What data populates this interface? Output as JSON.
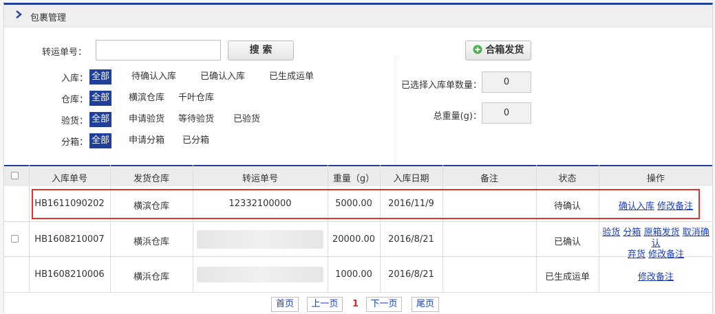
{
  "header": {
    "title": "包裹管理",
    "icon": "chevron-right-icon"
  },
  "filters": {
    "tracking_label": "转运单号：",
    "tracking_value": "",
    "search_label": "搜 索",
    "inbound": {
      "label": "入库：",
      "options": [
        "全部",
        "待确认入库",
        "已确认入库",
        "已生成运单"
      ],
      "selected": 0
    },
    "warehouse": {
      "label": "仓库：",
      "options": [
        "全部",
        "横滨仓库",
        "千叶仓库"
      ],
      "selected": 0
    },
    "inspection": {
      "label": "验货：",
      "options": [
        "全部",
        "申请验货",
        "等待验货",
        "已验货"
      ],
      "selected": 0
    },
    "boxing": {
      "label": "分箱：",
      "options": [
        "全部",
        "申请分箱",
        "已分箱"
      ],
      "selected": 0
    }
  },
  "summary": {
    "merge_label": "合箱发货",
    "merge_icon": "plus-circle-icon",
    "selected_count_label": "已选择入库单数量：",
    "selected_count": "0",
    "total_weight_label": "总重量(g)：",
    "total_weight": "0"
  },
  "table": {
    "headers": [
      "入库单号",
      "发货仓库",
      "转运单号",
      "重量（g）",
      "入库日期",
      "备注",
      "状态",
      "操作"
    ],
    "rows": [
      {
        "id": "HB1611090202",
        "warehouse": "横滨仓库",
        "tracking": "12332100000",
        "weight": "5000.00",
        "date": "2016/11/9",
        "note": "",
        "status": "待确认",
        "actions": [
          "确认入库",
          "修改备注"
        ],
        "has_checkbox": false,
        "highlighted": true
      },
      {
        "id": "HB1608210007",
        "warehouse": "横浜仓库",
        "tracking": "",
        "weight": "20000.00",
        "date": "2016/8/21",
        "note": "",
        "status": "已确认",
        "actions": [
          "验货",
          "分箱",
          "原箱发货",
          "取消确认",
          "弃货",
          "修改备注"
        ],
        "has_checkbox": true,
        "highlighted": false
      },
      {
        "id": "HB1608210006",
        "warehouse": "横浜仓库",
        "tracking": "",
        "weight": "1000.00",
        "date": "2016/8/21",
        "note": "",
        "status": "已生成运单",
        "actions": [
          "修改备注"
        ],
        "has_checkbox": false,
        "highlighted": false
      }
    ]
  },
  "pager": {
    "first": "首页",
    "prev": "上一页",
    "current": "1",
    "next": "下一页",
    "last": "尾页"
  },
  "colors": {
    "accent": "#1f3f9a",
    "link": "#1a3ec4",
    "highlight": "#e0322f",
    "current_page": "#d9261c"
  }
}
